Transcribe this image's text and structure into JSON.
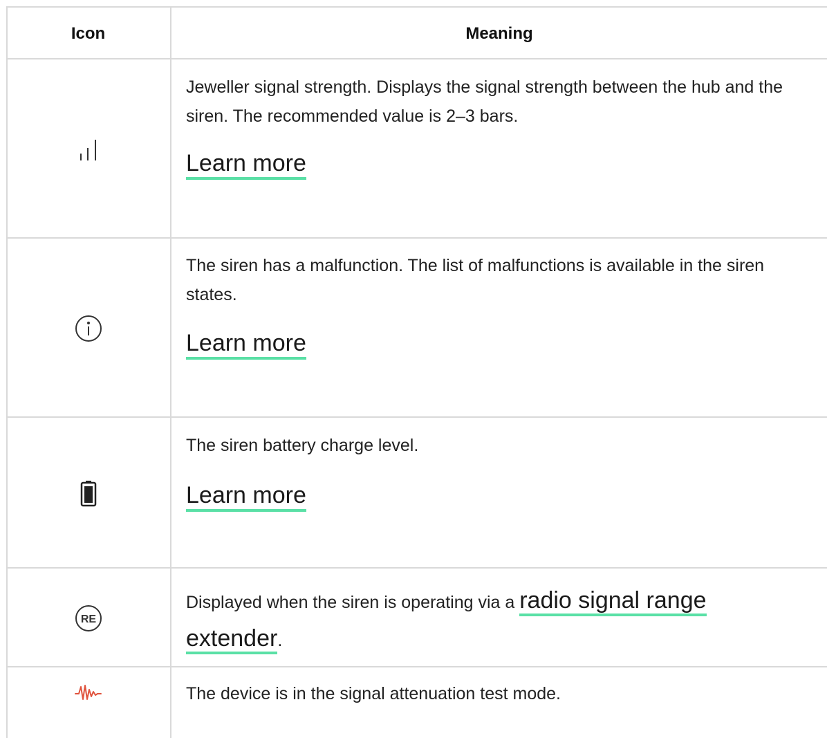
{
  "table": {
    "headers": {
      "icon": "Icon",
      "meaning": "Meaning"
    },
    "rows": [
      {
        "icon": "signal-strength-icon",
        "description": "Jeweller signal strength. Displays the signal strength between the hub and the siren. The recommended value is 2–3 bars.",
        "link": "Learn more"
      },
      {
        "icon": "info-circle-icon",
        "description": "The siren has a malfunction. The list of malfunctions is available in the siren states.",
        "link": "Learn more"
      },
      {
        "icon": "battery-icon",
        "description": "The siren battery charge level.",
        "link": "Learn more"
      },
      {
        "icon": "range-extender-icon",
        "description_prefix": "Displayed when the siren is operating via a ",
        "link_part1": "radio signal range",
        "link_part2": "extender",
        "description_suffix": "."
      },
      {
        "icon": "signal-attenuation-test-icon",
        "description": "The device is in the signal attenuation test mode."
      }
    ]
  },
  "colors": {
    "link_underline": "#5ae0a6",
    "grid_lines": "#d9d9d9",
    "attenuation_icon": "#e0533d"
  }
}
